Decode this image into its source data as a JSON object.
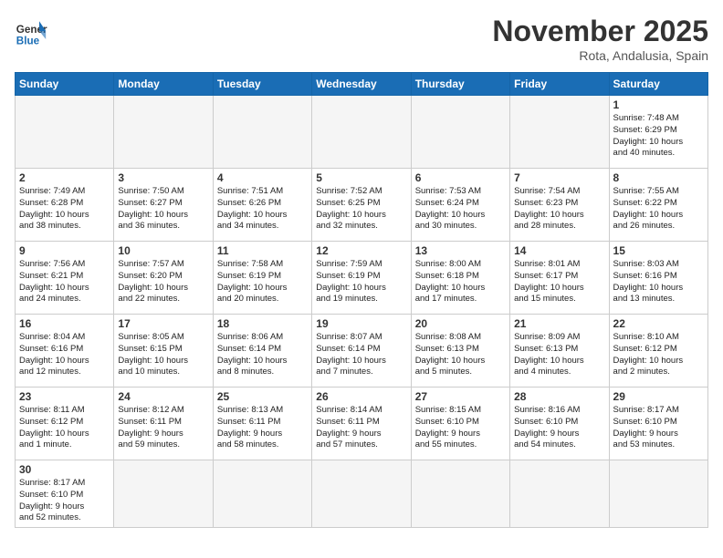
{
  "header": {
    "logo_general": "General",
    "logo_blue": "Blue",
    "month": "November 2025",
    "location": "Rota, Andalusia, Spain"
  },
  "weekdays": [
    "Sunday",
    "Monday",
    "Tuesday",
    "Wednesday",
    "Thursday",
    "Friday",
    "Saturday"
  ],
  "weeks": [
    [
      {
        "day": "",
        "info": ""
      },
      {
        "day": "",
        "info": ""
      },
      {
        "day": "",
        "info": ""
      },
      {
        "day": "",
        "info": ""
      },
      {
        "day": "",
        "info": ""
      },
      {
        "day": "",
        "info": ""
      },
      {
        "day": "1",
        "info": "Sunrise: 7:48 AM\nSunset: 6:29 PM\nDaylight: 10 hours\nand 40 minutes."
      }
    ],
    [
      {
        "day": "2",
        "info": "Sunrise: 7:49 AM\nSunset: 6:28 PM\nDaylight: 10 hours\nand 38 minutes."
      },
      {
        "day": "3",
        "info": "Sunrise: 7:50 AM\nSunset: 6:27 PM\nDaylight: 10 hours\nand 36 minutes."
      },
      {
        "day": "4",
        "info": "Sunrise: 7:51 AM\nSunset: 6:26 PM\nDaylight: 10 hours\nand 34 minutes."
      },
      {
        "day": "5",
        "info": "Sunrise: 7:52 AM\nSunset: 6:25 PM\nDaylight: 10 hours\nand 32 minutes."
      },
      {
        "day": "6",
        "info": "Sunrise: 7:53 AM\nSunset: 6:24 PM\nDaylight: 10 hours\nand 30 minutes."
      },
      {
        "day": "7",
        "info": "Sunrise: 7:54 AM\nSunset: 6:23 PM\nDaylight: 10 hours\nand 28 minutes."
      },
      {
        "day": "8",
        "info": "Sunrise: 7:55 AM\nSunset: 6:22 PM\nDaylight: 10 hours\nand 26 minutes."
      }
    ],
    [
      {
        "day": "9",
        "info": "Sunrise: 7:56 AM\nSunset: 6:21 PM\nDaylight: 10 hours\nand 24 minutes."
      },
      {
        "day": "10",
        "info": "Sunrise: 7:57 AM\nSunset: 6:20 PM\nDaylight: 10 hours\nand 22 minutes."
      },
      {
        "day": "11",
        "info": "Sunrise: 7:58 AM\nSunset: 6:19 PM\nDaylight: 10 hours\nand 20 minutes."
      },
      {
        "day": "12",
        "info": "Sunrise: 7:59 AM\nSunset: 6:19 PM\nDaylight: 10 hours\nand 19 minutes."
      },
      {
        "day": "13",
        "info": "Sunrise: 8:00 AM\nSunset: 6:18 PM\nDaylight: 10 hours\nand 17 minutes."
      },
      {
        "day": "14",
        "info": "Sunrise: 8:01 AM\nSunset: 6:17 PM\nDaylight: 10 hours\nand 15 minutes."
      },
      {
        "day": "15",
        "info": "Sunrise: 8:03 AM\nSunset: 6:16 PM\nDaylight: 10 hours\nand 13 minutes."
      }
    ],
    [
      {
        "day": "16",
        "info": "Sunrise: 8:04 AM\nSunset: 6:16 PM\nDaylight: 10 hours\nand 12 minutes."
      },
      {
        "day": "17",
        "info": "Sunrise: 8:05 AM\nSunset: 6:15 PM\nDaylight: 10 hours\nand 10 minutes."
      },
      {
        "day": "18",
        "info": "Sunrise: 8:06 AM\nSunset: 6:14 PM\nDaylight: 10 hours\nand 8 minutes."
      },
      {
        "day": "19",
        "info": "Sunrise: 8:07 AM\nSunset: 6:14 PM\nDaylight: 10 hours\nand 7 minutes."
      },
      {
        "day": "20",
        "info": "Sunrise: 8:08 AM\nSunset: 6:13 PM\nDaylight: 10 hours\nand 5 minutes."
      },
      {
        "day": "21",
        "info": "Sunrise: 8:09 AM\nSunset: 6:13 PM\nDaylight: 10 hours\nand 4 minutes."
      },
      {
        "day": "22",
        "info": "Sunrise: 8:10 AM\nSunset: 6:12 PM\nDaylight: 10 hours\nand 2 minutes."
      }
    ],
    [
      {
        "day": "23",
        "info": "Sunrise: 8:11 AM\nSunset: 6:12 PM\nDaylight: 10 hours\nand 1 minute."
      },
      {
        "day": "24",
        "info": "Sunrise: 8:12 AM\nSunset: 6:11 PM\nDaylight: 9 hours\nand 59 minutes."
      },
      {
        "day": "25",
        "info": "Sunrise: 8:13 AM\nSunset: 6:11 PM\nDaylight: 9 hours\nand 58 minutes."
      },
      {
        "day": "26",
        "info": "Sunrise: 8:14 AM\nSunset: 6:11 PM\nDaylight: 9 hours\nand 57 minutes."
      },
      {
        "day": "27",
        "info": "Sunrise: 8:15 AM\nSunset: 6:10 PM\nDaylight: 9 hours\nand 55 minutes."
      },
      {
        "day": "28",
        "info": "Sunrise: 8:16 AM\nSunset: 6:10 PM\nDaylight: 9 hours\nand 54 minutes."
      },
      {
        "day": "29",
        "info": "Sunrise: 8:17 AM\nSunset: 6:10 PM\nDaylight: 9 hours\nand 53 minutes."
      }
    ],
    [
      {
        "day": "30",
        "info": "Sunrise: 8:17 AM\nSunset: 6:10 PM\nDaylight: 9 hours\nand 52 minutes."
      },
      {
        "day": "",
        "info": ""
      },
      {
        "day": "",
        "info": ""
      },
      {
        "day": "",
        "info": ""
      },
      {
        "day": "",
        "info": ""
      },
      {
        "day": "",
        "info": ""
      },
      {
        "day": "",
        "info": ""
      }
    ]
  ]
}
